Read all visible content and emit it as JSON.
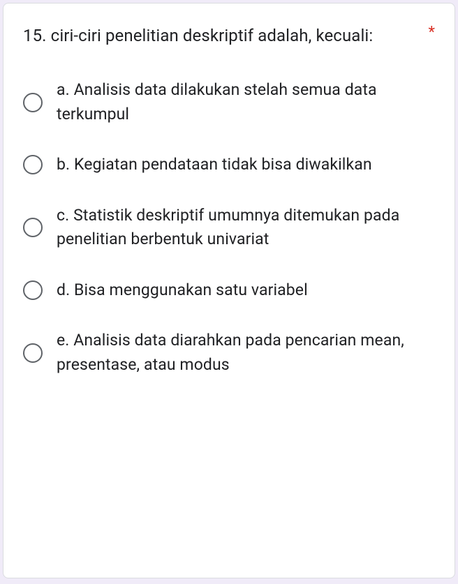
{
  "question": {
    "text": "15. ciri-ciri penelitian deskriptif adalah, kecuali:",
    "required_marker": "*"
  },
  "options": [
    {
      "label": "a. Analisis data dilakukan stelah semua data terkumpul"
    },
    {
      "label": "b. Kegiatan pendataan tidak bisa diwakilkan"
    },
    {
      "label": "c. Statistik deskriptif umumnya ditemukan pada penelitian berbentuk univariat"
    },
    {
      "label": "d. Bisa menggunakan satu variabel"
    },
    {
      "label": "e. Analisis data diarahkan pada pencarian mean, presentase, atau modus"
    }
  ]
}
